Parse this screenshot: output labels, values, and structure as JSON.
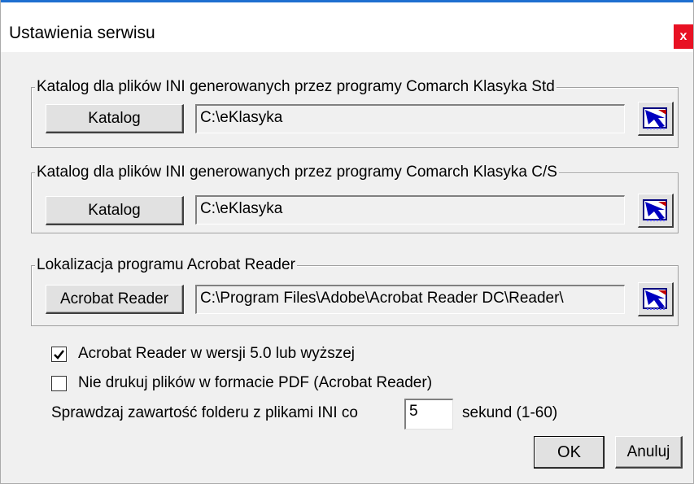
{
  "window": {
    "title": "Ustawienia serwisu",
    "close_label": "x"
  },
  "groups": [
    {
      "title": "Katalog dla plików INI generowanych przez programy Comarch Klasyka Std",
      "button_label": "Katalog",
      "path": "C:\\eKlasyka"
    },
    {
      "title": "Katalog dla plików INI generowanych przez programy Comarch Klasyka C/S",
      "button_label": "Katalog",
      "path": "C:\\eKlasyka"
    },
    {
      "title": "Lokalizacja programu Acrobat Reader",
      "button_label": "Acrobat Reader",
      "path": "C:\\Program Files\\Adobe\\Acrobat Reader DC\\Reader\\"
    }
  ],
  "options": {
    "acrobat5": {
      "label": "Acrobat Reader w wersji 5.0 lub wyższej",
      "checked": true
    },
    "no_pdf": {
      "label": "Nie drukuj plików w formacie PDF (Acrobat Reader)",
      "checked": false
    }
  },
  "interval": {
    "label": "Sprawdzaj zawartość folderu z plikami INI co",
    "value": "5",
    "suffix": "sekund (1-60)"
  },
  "buttons": {
    "ok": "OK",
    "cancel": "Anuluj"
  }
}
